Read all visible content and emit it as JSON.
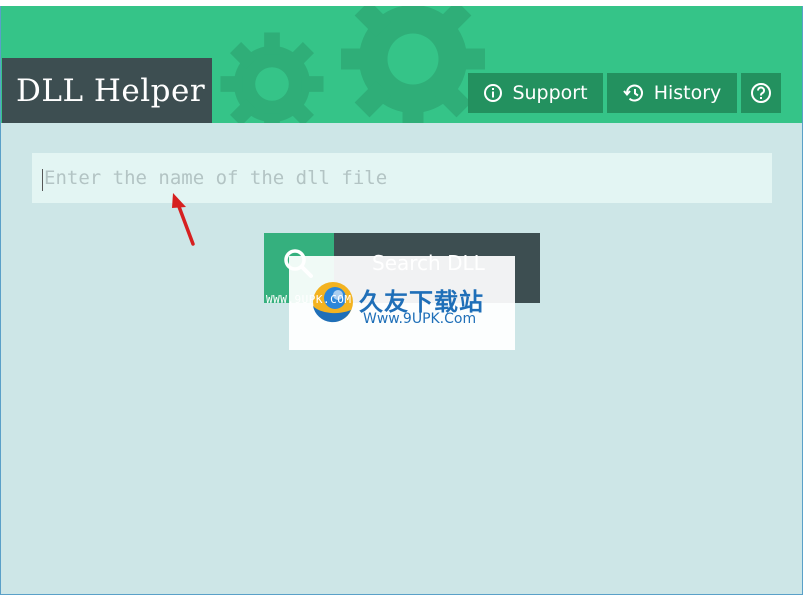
{
  "app": {
    "title": "DLL Helper"
  },
  "header": {
    "support_label": "Support",
    "history_label": "History",
    "support_icon": "info-circle-icon",
    "history_icon": "history-clock-icon",
    "help_icon": "question-circle-icon"
  },
  "search": {
    "placeholder": "Enter the name of the dll file",
    "value": "",
    "button_label": "Search DLL",
    "button_icon": "magnifier-icon"
  },
  "watermark": {
    "small_text": "WWW.9UPK.COM",
    "chinese_text": "久友下载站",
    "url": "Www.9UPK.Com"
  },
  "colors": {
    "header_green": "#35c488",
    "button_green": "#23915f",
    "dark_slate": "#3d4e51",
    "background": "#cde6e7",
    "input_bg": "#e3f5f3",
    "annotation_arrow": "#d62020"
  }
}
